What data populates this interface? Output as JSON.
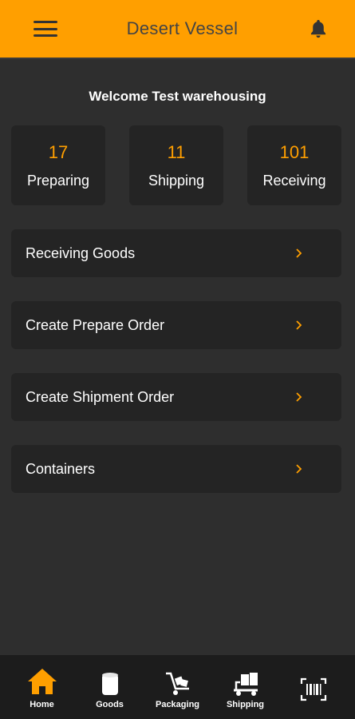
{
  "header": {
    "title": "Desert Vessel",
    "menu_icon": "hamburger-menu-icon",
    "notification_icon": "bell-icon"
  },
  "welcome": "Welcome Test warehousing",
  "stats": [
    {
      "value": "17",
      "label": "Preparing"
    },
    {
      "value": "11",
      "label": "Shipping"
    },
    {
      "value": "101",
      "label": "Receiving"
    }
  ],
  "menu": [
    {
      "label": "Receiving Goods"
    },
    {
      "label": "Create Prepare Order"
    },
    {
      "label": "Create Shipment Order"
    },
    {
      "label": "Containers"
    }
  ],
  "bottom_nav": [
    {
      "label": "Home",
      "icon": "home-icon",
      "active": true
    },
    {
      "label": "Goods",
      "icon": "goods-icon"
    },
    {
      "label": "Packaging",
      "icon": "packaging-icon"
    },
    {
      "label": "Shipping",
      "icon": "shipping-icon"
    },
    {
      "label": "",
      "icon": "barcode-scanner-icon"
    }
  ],
  "colors": {
    "accent": "#ff9f00",
    "background": "#2e2e2e",
    "card": "#242424",
    "nav": "#1c1c1c"
  }
}
